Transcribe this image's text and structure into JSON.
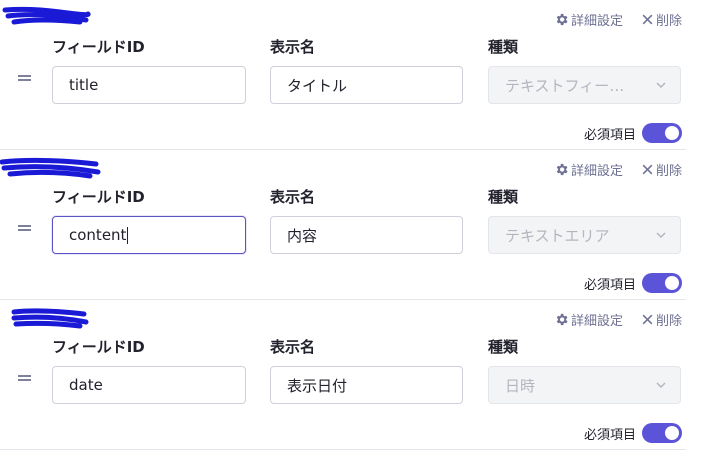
{
  "labels": {
    "field_id": "フィールドID",
    "display_name": "表示名",
    "type": "種類",
    "settings": "詳細設定",
    "delete": "削除",
    "required": "必須項目"
  },
  "fields": [
    {
      "field_id": "title",
      "display_name": "タイトル",
      "type": "テキストフィー…",
      "required": true
    },
    {
      "field_id": "content",
      "display_name": "内容",
      "type": "テキストエリア",
      "required": true
    },
    {
      "field_id": "date",
      "display_name": "表示日付",
      "type": "日時",
      "required": true
    }
  ],
  "colors": {
    "accent": "#5b54d8",
    "redaction": "#1a1ad6"
  }
}
